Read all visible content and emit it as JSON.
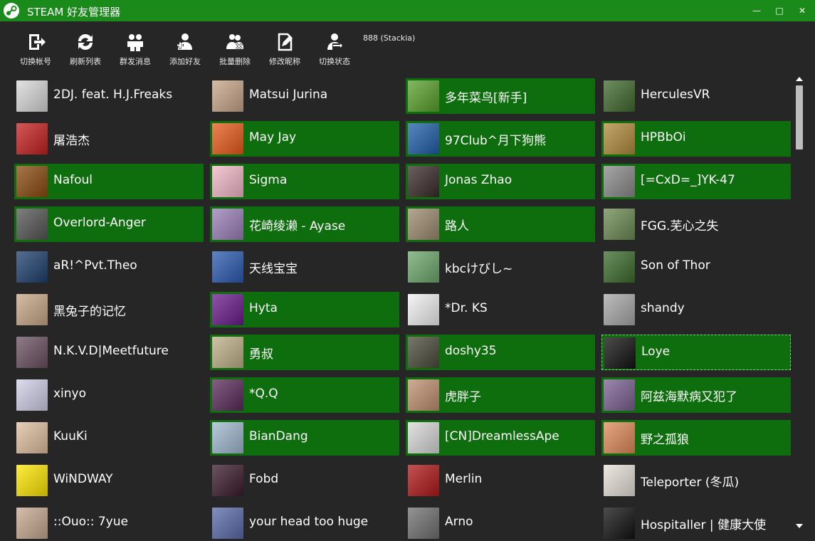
{
  "window": {
    "title": "STEAM 好友管理器",
    "minimize": "—",
    "maximize": "□",
    "close": "✕"
  },
  "toolbar": {
    "buttons": [
      {
        "label": "切换帐号",
        "icon": "switch-account-icon"
      },
      {
        "label": "刷新列表",
        "icon": "refresh-icon"
      },
      {
        "label": "群发消息",
        "icon": "broadcast-message-icon"
      },
      {
        "label": "添加好友",
        "icon": "add-friend-icon"
      },
      {
        "label": "批量删除",
        "icon": "batch-delete-icon"
      },
      {
        "label": "修改昵称",
        "icon": "edit-nickname-icon"
      },
      {
        "label": "切换状态",
        "icon": "switch-status-icon"
      }
    ],
    "account": "888 (Stackia)"
  },
  "colors": {
    "title_bar": "#1a8a1a",
    "background": "#262626",
    "online_cell": "#0e6e0e",
    "selected_border": "#7fd07f"
  },
  "friends": [
    {
      "name": "2DJ. feat. H.J.Freaks",
      "online": false,
      "avatar_color": "#d9d9d9"
    },
    {
      "name": "Matsui Jurina",
      "online": false,
      "avatar_color": "#c9a58a"
    },
    {
      "name": "多年菜鸟[新手]",
      "online": true,
      "avatar_color": "#5aa02c"
    },
    {
      "name": "HerculesVR",
      "online": false,
      "avatar_color": "#3f6a2d"
    },
    {
      "name": "屠浩杰",
      "online": false,
      "avatar_color": "#c62020"
    },
    {
      "name": "May Jay",
      "online": true,
      "avatar_color": "#e85a1a"
    },
    {
      "name": "97Club^月下狗熊",
      "online": true,
      "avatar_color": "#1f5fa8"
    },
    {
      "name": "HPBbOi",
      "online": true,
      "avatar_color": "#b08a3c"
    },
    {
      "name": "Nafoul",
      "online": true,
      "avatar_color": "#8a4a10"
    },
    {
      "name": "Sigma",
      "online": true,
      "avatar_color": "#f2b8c8"
    },
    {
      "name": "Jonas Zhao",
      "online": true,
      "avatar_color": "#3a2a2a"
    },
    {
      "name": "[=CxD=_]YK-47",
      "online": true,
      "avatar_color": "#8a8a8a"
    },
    {
      "name": "Overlord-Anger",
      "online": true,
      "avatar_color": "#555555"
    },
    {
      "name": "花崎绫濑 - Ayase",
      "online": true,
      "avatar_color": "#9b7fb8"
    },
    {
      "name": "路人",
      "online": true,
      "avatar_color": "#9e8a70"
    },
    {
      "name": "FGG.芜心之失",
      "online": false,
      "avatar_color": "#6a8a50"
    },
    {
      "name": "aR!^Pvt.Theo",
      "online": false,
      "avatar_color": "#1d3f6e"
    },
    {
      "name": "天线宝宝",
      "online": false,
      "avatar_color": "#2a5ab0"
    },
    {
      "name": "kbcけびし~",
      "online": false,
      "avatar_color": "#6da86d"
    },
    {
      "name": "Son of Thor",
      "online": false,
      "avatar_color": "#3b6b2b"
    },
    {
      "name": "黑兔子的记忆",
      "online": false,
      "avatar_color": "#c8a888"
    },
    {
      "name": "Hyta",
      "online": true,
      "avatar_color": "#6a1a8a"
    },
    {
      "name": "*Dr. KS",
      "online": false,
      "avatar_color": "#f2f2f2"
    },
    {
      "name": "shandy",
      "online": false,
      "avatar_color": "#a8a8a8"
    },
    {
      "name": "N.K.V.D|Meetfuture",
      "online": false,
      "avatar_color": "#6a5060"
    },
    {
      "name": "勇叔",
      "online": true,
      "avatar_color": "#c0b088"
    },
    {
      "name": "doshy35",
      "online": true,
      "avatar_color": "#4a4a3a"
    },
    {
      "name": "Loye",
      "online": true,
      "selected": true,
      "avatar_color": "#111111"
    },
    {
      "name": "xinyo",
      "online": false,
      "avatar_color": "#d0d0e8"
    },
    {
      "name": "*Q.Q",
      "online": true,
      "avatar_color": "#5a2a5a"
    },
    {
      "name": "虎胖子",
      "online": true,
      "avatar_color": "#c09070"
    },
    {
      "name": "阿兹海默病又犯了",
      "online": true,
      "avatar_color": "#7a6090"
    },
    {
      "name": "KuuKi",
      "online": false,
      "avatar_color": "#e0c0a0"
    },
    {
      "name": "BianDang",
      "online": true,
      "avatar_color": "#a0b8d0"
    },
    {
      "name": "[CN]DreamlessApe",
      "online": true,
      "avatar_color": "#d8d8d8"
    },
    {
      "name": "野之孤狼",
      "online": true,
      "avatar_color": "#e08a5a"
    },
    {
      "name": "WiNDWAY",
      "online": false,
      "avatar_color": "#ffe600"
    },
    {
      "name": "Fobd",
      "online": false,
      "avatar_color": "#3a1a2a"
    },
    {
      "name": "Merlin",
      "online": false,
      "avatar_color": "#b01818"
    },
    {
      "name": "Teleporter (冬瓜)",
      "online": false,
      "avatar_color": "#e8e0d8"
    },
    {
      "name": "::Ouo:: 7yue",
      "online": false,
      "avatar_color": "#c8a890"
    },
    {
      "name": "your head too huge",
      "online": false,
      "avatar_color": "#5a6aa8"
    },
    {
      "name": "Arno",
      "online": false,
      "avatar_color": "#707070"
    },
    {
      "name": "Hospitaller | 健康大使",
      "online": false,
      "avatar_color": "#111111"
    }
  ],
  "scrollbar": {
    "up": "▲",
    "down": "▼"
  }
}
